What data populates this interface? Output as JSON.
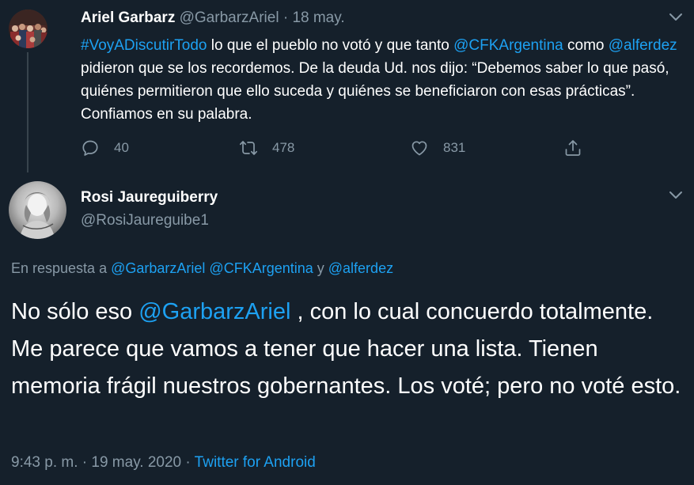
{
  "parent_tweet": {
    "name": "Ariel Garbarz",
    "handle": "@GarbarzAriel",
    "separator": "·",
    "date": "18 may.",
    "text": {
      "hashtag": "#VoyADiscutirTodo",
      "part1": " lo que el pueblo no votó y que tanto ",
      "mention1": "@CFKArgentina",
      "part2_prefix": " como ",
      "mention2": "@alferdez",
      "part3": " pidieron que se los recordemos. De la deuda Ud. nos dijo: “Debemos saber lo que pasó, quiénes permitieron que ello suceda y quiénes se beneficiaron con esas prácticas”. Confiamos en su palabra."
    },
    "actions": {
      "reply_count": "40",
      "retweet_count": "478",
      "like_count": "831"
    }
  },
  "main_tweet": {
    "name": "Rosi Jaureguiberry",
    "handle": "@RosiJaureguibe1",
    "reply_to": {
      "prefix": "En respuesta a ",
      "mention1": "@GarbarzAriel",
      "mention2": "@CFKArgentina",
      "connector": " y ",
      "mention3": "@alferdez"
    },
    "text": {
      "part1": "No sólo eso ",
      "mention": "@GarbarzAriel",
      "part2": " , con lo cual concuerdo totalmente. Me parece que vamos a tener que hacer una lista. Tienen memoria frágil nuestros gobernantes. Los voté; pero no voté esto."
    },
    "meta": {
      "time": "9:43 p. m.",
      "separator1": " · ",
      "date": "19 may. 2020",
      "separator2": " · ",
      "source": "Twitter for Android"
    }
  },
  "icons": {
    "reply": "reply-icon",
    "retweet": "retweet-icon",
    "like": "heart-icon",
    "share": "share-icon",
    "caret": "chevron-down-icon"
  },
  "colors": {
    "background": "#15202b",
    "link": "#1da1f2",
    "muted": "#8899a6",
    "text": "#ffffff",
    "thread_line": "#38444d"
  }
}
